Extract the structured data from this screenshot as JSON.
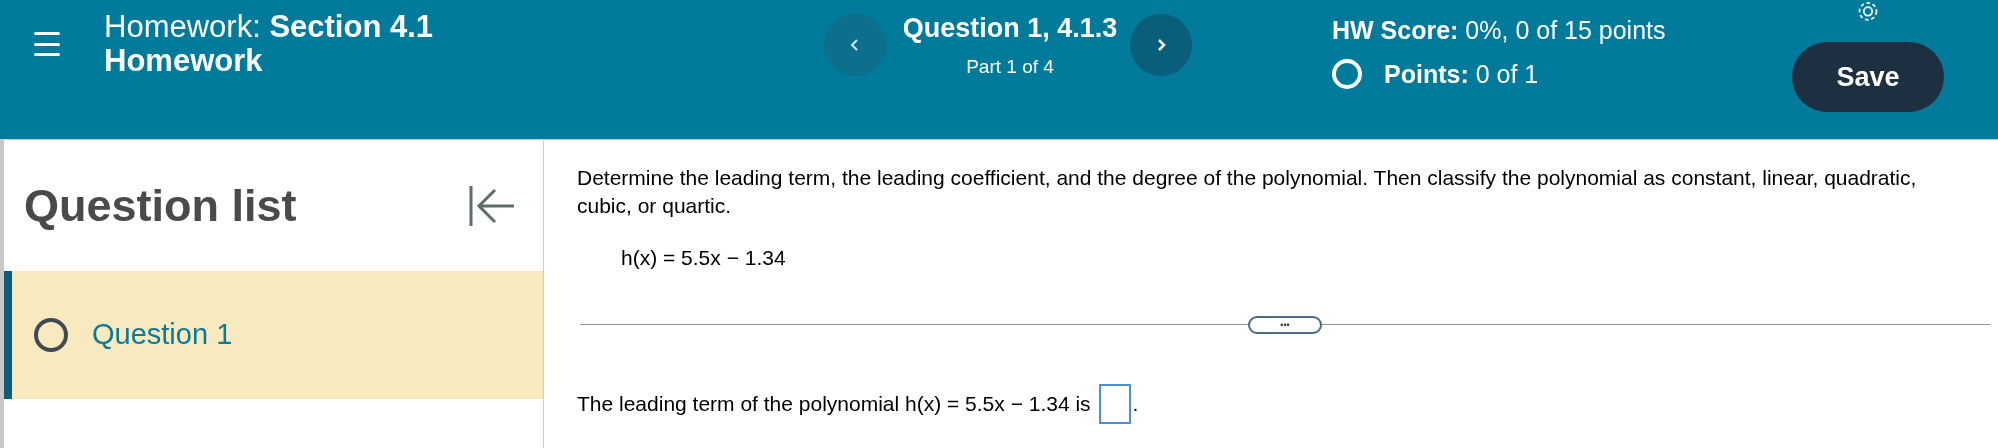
{
  "header": {
    "title_prefix": "Homework:",
    "title": "Section 4.1 Homework",
    "question": "Question 1, 4.1.3",
    "part": "Part 1 of 4",
    "score_label": "HW Score:",
    "score": "0%, 0 of 15 points",
    "points_label": "Points:",
    "points": "0 of 1",
    "points_complete": false,
    "save": "Save"
  },
  "sidebar": {
    "title": "Question list",
    "items": [
      {
        "label": "Question 1",
        "selected": true,
        "complete": false
      }
    ]
  },
  "question": {
    "prompt": "Determine the leading term, the leading coefficient, and the degree of the polynomial. Then classify the polynomial as constant, linear, quadratic, cubic, or quartic.",
    "equation": "h(x) = 5.5x − 1.34",
    "expand": "•••",
    "answer_prefix": "The leading term of the polynomial h(x) = 5.5x − 1.34 is",
    "answer_suffix": "."
  }
}
